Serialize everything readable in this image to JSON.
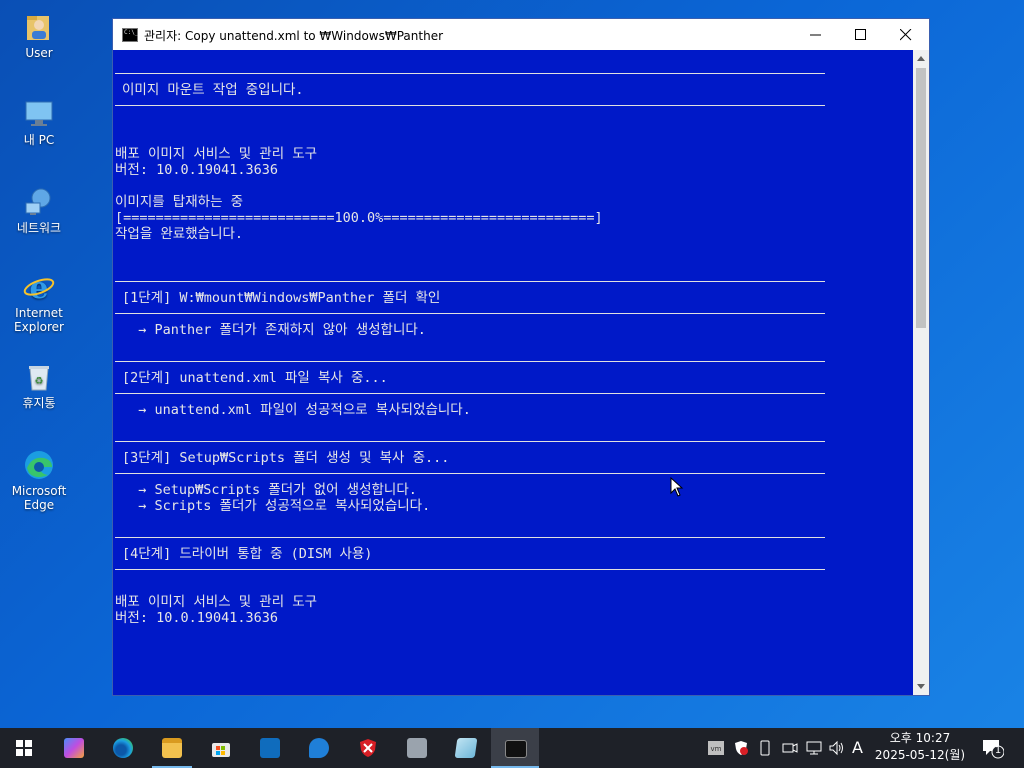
{
  "desktop": {
    "icons": [
      {
        "label": "User",
        "icon": "user-folder-icon"
      },
      {
        "label": "내 PC",
        "icon": "computer-icon"
      },
      {
        "label": "네트워크",
        "icon": "network-icon"
      },
      {
        "label": "Internet Explorer",
        "icon": "internet-explorer-icon"
      },
      {
        "label": "휴지통",
        "icon": "recycle-bin-icon"
      },
      {
        "label": "Microsoft Edge",
        "icon": "edge-icon"
      }
    ]
  },
  "window": {
    "title": "관리자:  Copy unattend.xml to ₩Windows₩Panther",
    "console_bg": "#0019c8",
    "lines": [
      "이미지 마운트 작업 중입니다.",
      "배포 이미지 서비스 및 관리 도구",
      "버전: 10.0.19041.3636",
      "이미지를 탑재하는 중",
      "[==========================100.0%==========================]",
      "작업을 완료했습니다.",
      "[1단계] W:₩mount₩Windows₩Panther 폴더 확인",
      "  → Panther 폴더가 존재하지 않아 생성합니다.",
      "[2단계] unattend.xml 파일 복사 중...",
      "  → unattend.xml 파일이 성공적으로 복사되었습니다.",
      "[3단계] Setup₩Scripts 폴더 생성 및 복사 중...",
      "  → Setup₩Scripts 폴더가 없어 생성합니다.",
      "  → Scripts 폴더가 성공적으로 복사되었습니다.",
      "[4단계] 드라이버 통합 중 (DISM 사용)",
      "배포 이미지 서비스 및 관리 도구",
      "버전: 10.0.19041.3636"
    ]
  },
  "taskbar": {
    "apps": [
      "start",
      "copilot",
      "edge",
      "file-explorer",
      "microsoft-store",
      "outlook",
      "defender",
      "security-app",
      "app-installer",
      "notepad",
      "command-prompt"
    ],
    "tray_input_indicator": "A",
    "clock_time": "오후 10:27",
    "clock_date": "2025-05-12(월)",
    "notification_count": "1"
  }
}
